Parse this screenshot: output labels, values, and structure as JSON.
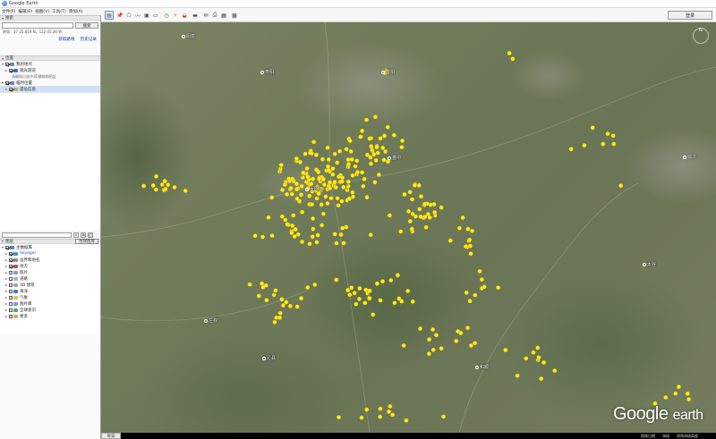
{
  "window": {
    "title": "Google Earth"
  },
  "menu": [
    "文件(F)",
    "编辑(E)",
    "视图(V)",
    "工具(T)",
    "添加(A)"
  ],
  "toolbar": {
    "buttons": [
      "sidebar-icon",
      "placemark-icon",
      "polygon-icon",
      "path-icon",
      "overlay-icon",
      "tour-icon",
      "history-icon",
      "sun-icon",
      "planet-icon",
      "ruler-icon",
      "email-icon",
      "print-icon",
      "save-image-icon",
      "maps-icon"
    ],
    "login_label": "登录"
  },
  "search": {
    "section_label": "搜索",
    "input_value": "",
    "button_label": "搜索",
    "coord_text": "例如：37 25.819 N，122 05.36 W",
    "link_directions": "获取路线",
    "link_history": "历史记录"
  },
  "places": {
    "section_label": "位置",
    "items": [
      {
        "label": "我的地点",
        "depth": 0,
        "expand": "▾",
        "checked": true,
        "color": "#6a84c6",
        "selected": false
      },
      {
        "label": "观光游览",
        "depth": 1,
        "expand": "▸",
        "checked": true,
        "color": "#3d6ccc",
        "selected": false
      },
      {
        "label": "请确保已选中3D建筑物图层",
        "depth": 2,
        "expand": "",
        "checked": false,
        "color": "",
        "selected": false
      },
      {
        "label": "临时位置",
        "depth": 0,
        "expand": "▾",
        "checked": true,
        "color": "#6a84c6",
        "selected": false
      },
      {
        "label": "遗址信息",
        "depth": 1,
        "expand": "▸",
        "checked": true,
        "color": "#c9a85e",
        "selected": true
      }
    ]
  },
  "layers": {
    "section_label": "图层",
    "gallery_label": "地球图库",
    "items": [
      {
        "label": "主数据库",
        "checked": true,
        "color": "#5d7ec4"
      },
      {
        "label": "Voyager",
        "checked": true,
        "color": "#4c8fd6",
        "highlight": true
      },
      {
        "label": "边界和地名",
        "checked": true,
        "color": "#8c8c8c"
      },
      {
        "label": "地方",
        "checked": true,
        "color": "#c24f4f"
      },
      {
        "label": "照片",
        "checked": false,
        "color": "#7fa1d6"
      },
      {
        "label": "道路",
        "checked": false,
        "color": "#b3b3b3"
      },
      {
        "label": "3D 建筑",
        "checked": false,
        "color": "#9aa7b5"
      },
      {
        "label": "海洋",
        "checked": false,
        "color": "#3f7ad3"
      },
      {
        "label": "气象",
        "checked": false,
        "color": "#d1c35a"
      },
      {
        "label": "图片库",
        "checked": false,
        "color": "#7a9bd1"
      },
      {
        "label": "全球意识",
        "checked": false,
        "color": "#55a866"
      },
      {
        "label": "更多",
        "checked": false,
        "color": "#c9b15a"
      }
    ]
  },
  "status_tab": "导览",
  "map": {
    "city_labels": [
      "阳泉",
      "寿阳",
      "昔阳",
      "太原市",
      "晋中",
      "榆次",
      "太谷",
      "和顺",
      "左权",
      "沁县"
    ],
    "pin_color": "#ffeb1a",
    "logo_text_google": "Google",
    "logo_text_earth": "earth",
    "footer": [
      "图像日期",
      "海拔",
      "视角海拔高度"
    ]
  }
}
